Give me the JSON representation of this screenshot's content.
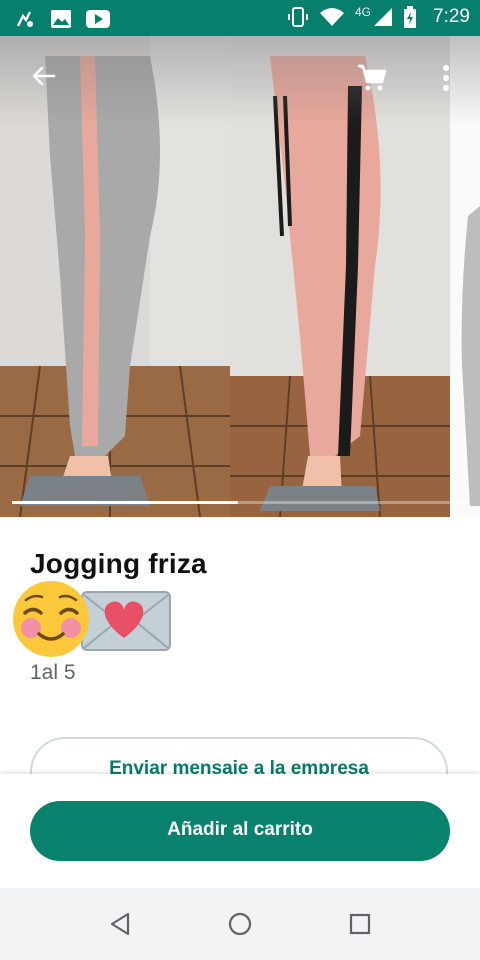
{
  "status_bar": {
    "time": "7:29",
    "network": "4G"
  },
  "product": {
    "title": "Jogging friza",
    "description": "1al 5"
  },
  "actions": {
    "message_label": "Enviar mensaje a la empresa",
    "add_to_cart_label": "Añadir al carrito"
  },
  "gallery": {
    "current_image": 1,
    "total_images": 3
  },
  "colors": {
    "primary": "#08826c",
    "status_bar": "#06806c",
    "pants_gray": "#a9a9a9",
    "pants_pink": "#e9a89c",
    "stripe_black": "#1b1b1b"
  },
  "icons": [
    "back-arrow-icon",
    "cart-icon",
    "more-vertical-icon",
    "smiling-face-icon",
    "love-letter-icon",
    "nav-back-icon",
    "nav-home-icon",
    "nav-recents-icon"
  ]
}
